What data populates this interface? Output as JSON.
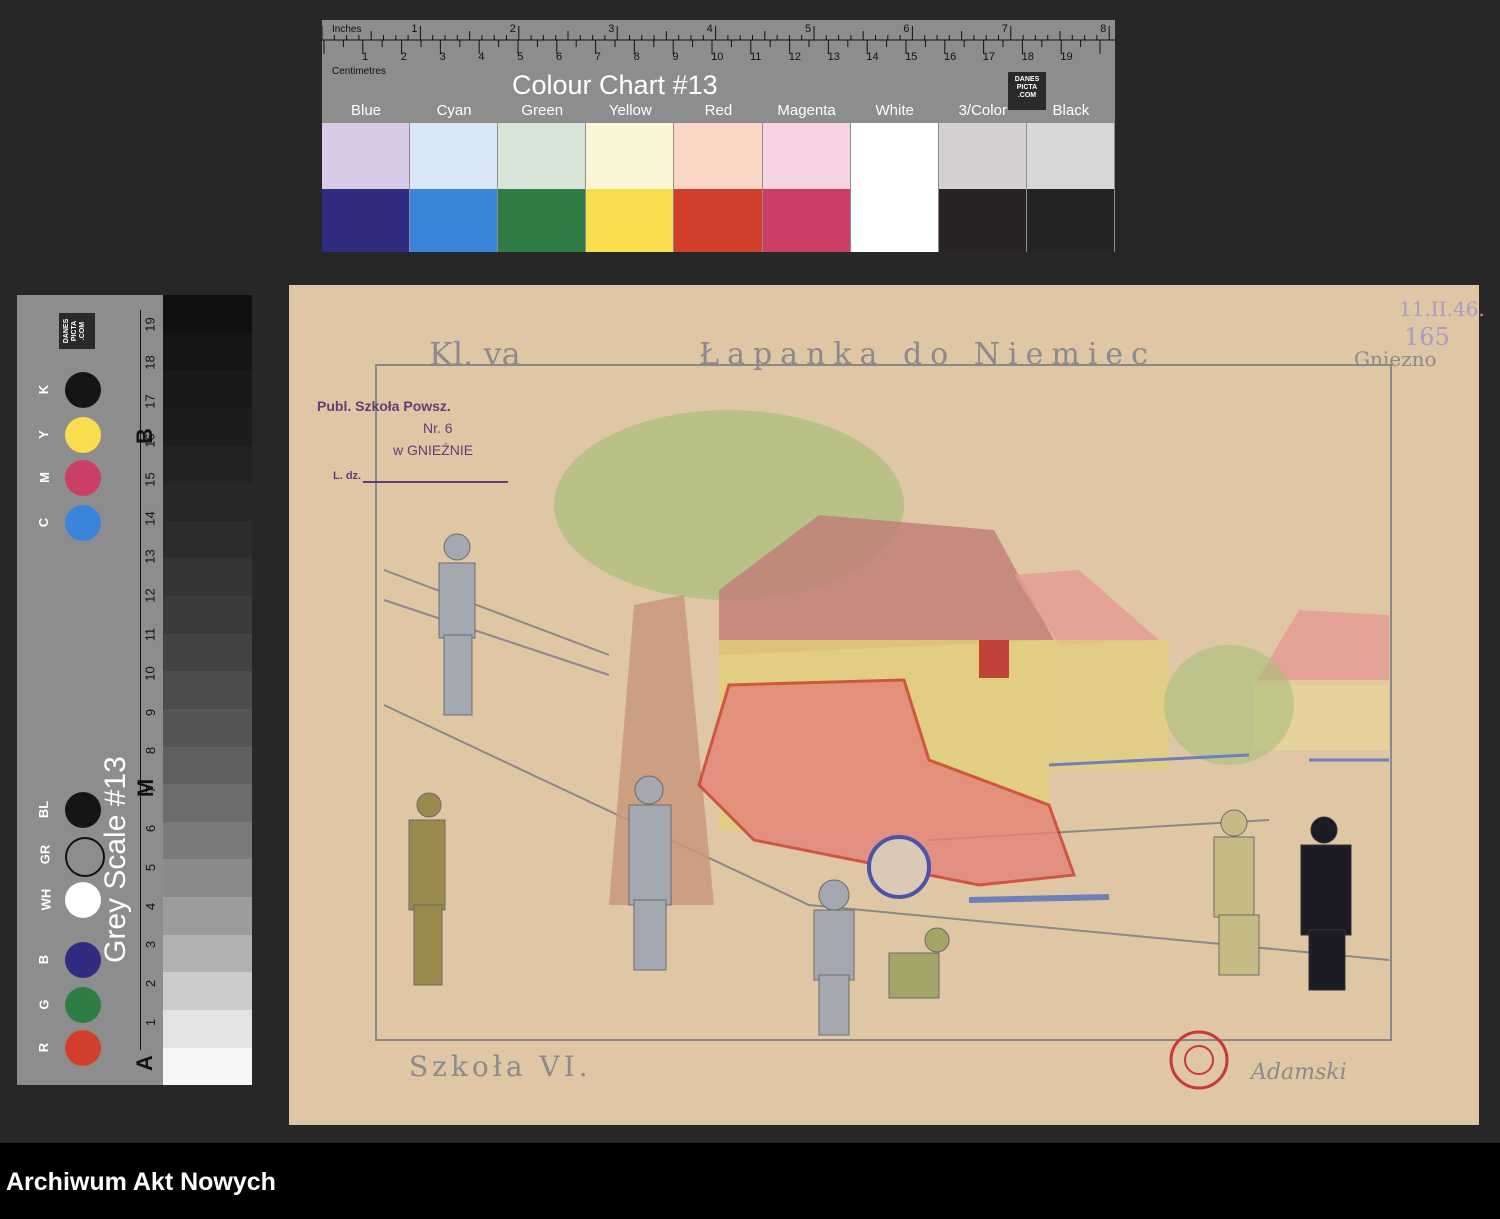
{
  "colour_chart": {
    "title": "Colour Chart #13",
    "inches_label": "Inches",
    "centimetres_label": "Centimetres",
    "logo_text": "DANES PICTA .COM",
    "inch_marks": [
      "1",
      "2",
      "3",
      "4",
      "5",
      "6",
      "7",
      "8"
    ],
    "cm_marks": [
      "1",
      "2",
      "3",
      "4",
      "5",
      "6",
      "7",
      "8",
      "9",
      "10",
      "11",
      "12",
      "13",
      "14",
      "15",
      "16",
      "17",
      "18",
      "19"
    ],
    "swatches": [
      {
        "label": "Blue",
        "light": "#d9cbe6",
        "dark": "#302c80"
      },
      {
        "label": "Cyan",
        "light": "#d9e6f6",
        "dark": "#3a84dc"
      },
      {
        "label": "Green",
        "light": "#d8e6d8",
        "dark": "#2f7c47"
      },
      {
        "label": "Yellow",
        "light": "#fbf6d8",
        "dark": "#f8de4e"
      },
      {
        "label": "Red",
        "light": "#f9d6c6",
        "dark": "#d2402d"
      },
      {
        "label": "Magenta",
        "light": "#f6d4e4",
        "dark": "#cc3f65"
      },
      {
        "label": "White",
        "light": "#ffffff",
        "dark": "#ffffff"
      },
      {
        "label": "3/Color",
        "light": "#d5d0d2",
        "dark": "#2a2326"
      },
      {
        "label": "Black",
        "light": "#d8d8da",
        "dark": "#242424"
      }
    ]
  },
  "grey_scale": {
    "title": "Grey Scale #13",
    "logo_text": "DANES PICTA .COM",
    "letters": [
      "A",
      "M",
      "B"
    ],
    "numbers": [
      "1",
      "2",
      "3",
      "4",
      "5",
      "6",
      "7",
      "8",
      "9",
      "10",
      "11",
      "12",
      "13",
      "14",
      "15",
      "16",
      "17",
      "18",
      "19"
    ],
    "color_dots": [
      {
        "label": "R",
        "color": "#d2402d"
      },
      {
        "label": "G",
        "color": "#2f7c47"
      },
      {
        "label": "B",
        "color": "#302c80"
      },
      {
        "label": "WH",
        "color": "#ffffff"
      },
      {
        "label": "GR",
        "color": "#8d8d8d"
      },
      {
        "label": "BL",
        "color": "#151515"
      },
      {
        "label": "C",
        "color": "#3a84dc"
      },
      {
        "label": "M",
        "color": "#cc3f65"
      },
      {
        "label": "Y",
        "color": "#f8de4e"
      },
      {
        "label": "K",
        "color": "#151515"
      }
    ]
  },
  "drawing": {
    "header_left": "Kl. va",
    "header_title": "Łapanka do Niemiec",
    "header_right": "Gniezno",
    "corner_note_date": "11.II.46.",
    "corner_note_number": "165",
    "stamp_line1": "Publ. Szkoła Powsz.",
    "stamp_line2": "Nr. 6",
    "stamp_line3": "w GNIEŹNIE",
    "stamp_line4": "L. dz.",
    "footer_left": "Szkoła VI.",
    "signature": "Adamski"
  },
  "footer": {
    "archive_name": "Archiwum Akt Nowych"
  }
}
